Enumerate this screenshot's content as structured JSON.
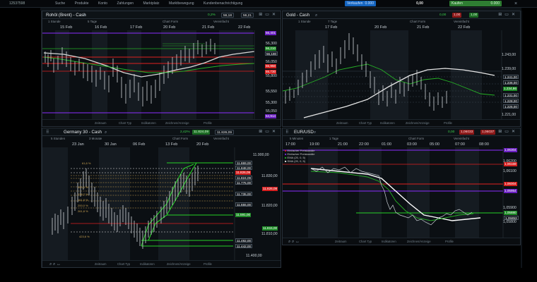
{
  "topbar": {
    "account": "12537598",
    "nav": [
      "Suche",
      "Produkte",
      "Konto",
      "Zahlungen",
      "Marktplatz",
      "Marktbewegung",
      "Kundenbenachrichtigung"
    ],
    "sell_label": "Verkaufen",
    "sell_value": "0.000",
    "mid_value": "0,00",
    "buy_label": "Kaufen",
    "buy_value": "0.000",
    "colors": {
      "sell": "#1565c0",
      "buy": "#2e7d32"
    }
  },
  "panels": [
    {
      "id": "brent",
      "title": "Rohöl (Brent) - Cash",
      "change": "0,2%",
      "sell": "56,18",
      "buy": "56,21",
      "toolbar": [
        "1 Stunde",
        "5 Tage",
        "Chart Form",
        "Vereinfacht"
      ],
      "dates": [
        "15 Feb",
        "16 Feb",
        "17 Feb",
        "20 Feb",
        "21 Feb",
        "22 Feb"
      ],
      "axis": [
        "56,300",
        "56,050",
        "55,800",
        "55,550",
        "55,300",
        "55,050"
      ],
      "price_tags": [
        {
          "text": "56,401",
          "color": "#6a1fc2"
        },
        {
          "text": "56,210",
          "color": "#1d8a26"
        },
        {
          "text": "56,180",
          "color": "#10151a"
        },
        {
          "text": "55,950",
          "color": "#d61e1e"
        },
        {
          "text": "55,730",
          "color": "#d61e1e"
        },
        {
          "text": "54,914",
          "color": "#6a1fc2"
        }
      ],
      "footer": [
        "Zeitraum",
        "Chart Typ",
        "Indikatoren",
        "Zeichnen/Anzeige",
        "Profile"
      ]
    },
    {
      "id": "gold",
      "title": "Gold - Cash",
      "change": "0,00",
      "sell": "1,00",
      "buy": "1,00",
      "toolbar": [
        "1 Stunde",
        "7 Tage",
        "Chart Form",
        "Vereinfacht"
      ],
      "dates": [
        "17 Feb",
        "20 Feb",
        "21 Feb",
        "22 Feb"
      ],
      "axis": [
        "1.243,00",
        "1.239,00",
        "1.221,00"
      ],
      "price_tags": [
        {
          "text": "1.241,00",
          "color": "#10151a"
        },
        {
          "text": "1.236,00",
          "color": "#10151a"
        },
        {
          "text": "1.234,86",
          "color": "#1d8a26"
        },
        {
          "text": "1.231,00",
          "color": "#10151a"
        },
        {
          "text": "1.228,00",
          "color": "#10151a"
        },
        {
          "text": "1.225,00",
          "color": "#10151a"
        }
      ],
      "footer": [
        "Zeitraum",
        "Chart Typ",
        "Indikatoren",
        "Zeichnen/Anzeige",
        "Profile"
      ]
    },
    {
      "id": "dax",
      "title": "Germany 30 - Cash",
      "change": "2,42%",
      "sell": "11.824,09",
      "buy": "11.826,09",
      "toolbar": [
        "5 Stunden",
        "3 Monate",
        "Chart Form",
        "Vereinfacht"
      ],
      "dates": [
        "23 Jan",
        "30 Jan",
        "06 Feb",
        "13 Feb",
        "20 Feb"
      ],
      "axis": [
        "11.900,00",
        "11.830,00",
        "11.820,00",
        "11.810,00",
        "11.400,00"
      ],
      "price_tags": [
        {
          "text": "11.869,00",
          "color": "#10151a"
        },
        {
          "text": "11.848,00",
          "color": "#10151a"
        },
        {
          "text": "11.826,09",
          "color": "#d61e1e"
        },
        {
          "text": "11.824,09",
          "color": "#10151a"
        },
        {
          "text": "11.775,00",
          "color": "#10151a"
        },
        {
          "text": "11.735,00",
          "color": "#10151a"
        },
        {
          "text": "11.655,00",
          "color": "#10151a"
        },
        {
          "text": "11.591,00",
          "color": "#1d8a26"
        },
        {
          "text": "11.492,00",
          "color": "#10151a"
        },
        {
          "text": "11.442,00",
          "color": "#10151a"
        }
      ],
      "left_tags": [
        "11.826,09",
        "11.815,00"
      ],
      "fib_labels": [
        "61,8 %",
        "100,0 %",
        "138,2 %",
        "161,8 %",
        "200,0 %",
        "261,8 %",
        "423,6 %"
      ],
      "footer": [
        "Zeitraum",
        "Chart Typ",
        "Indikatoren",
        "Zeichnen/Anzeige",
        "Profile"
      ]
    },
    {
      "id": "eurusd",
      "title": "EUR/USD",
      "change": "0,00",
      "sell": "1,06033",
      "buy": "1,06037",
      "toolbar": [
        "5 Minuten",
        "1 Tage",
        "Chart Form",
        "Vereinfacht"
      ],
      "dates": [
        "17:00",
        "19:00",
        "21:00",
        "22:00",
        "01:00",
        "03:00",
        "05:00",
        "07:00",
        "08:00"
      ],
      "axis": [
        "1,06200",
        "1,06100",
        "1,05900",
        "1,05800"
      ],
      "price_tags": [
        {
          "text": "1,06304",
          "color": "#6a1fc2"
        },
        {
          "text": "1,06169",
          "color": "#d61e1e"
        },
        {
          "text": "1,06004",
          "color": "#d61e1e"
        },
        {
          "text": "1,05954",
          "color": "#6a1fc2"
        },
        {
          "text": "1,05880",
          "color": "#1d8a26"
        },
        {
          "text": "1,05853",
          "color": "#10151a"
        }
      ],
      "legend": [
        {
          "text": "Einfacher Preiskanäle",
          "color": "#e02020"
        },
        {
          "text": "Einfacher Preiskanäle",
          "color": "#7b2ad8"
        },
        {
          "text": "EMA (20, 0, 5)",
          "color": "#26b126"
        },
        {
          "text": "SMA (20, 0, 5)",
          "color": "#e6e6e6"
        }
      ],
      "footer": [
        "Zeitraum",
        "Chart Typ",
        "Indikatoren",
        "Zeichnen/Anzeige",
        "Profile"
      ]
    }
  ]
}
